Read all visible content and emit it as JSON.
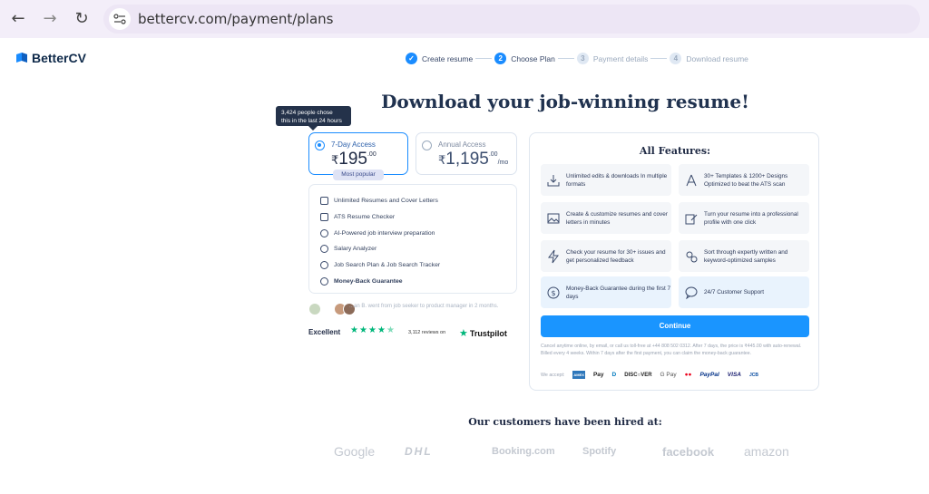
{
  "browser": {
    "url": "bettercv.com/payment/plans",
    "back_icon": "←",
    "forward_icon": "→",
    "reload_icon": "↻"
  },
  "logo": {
    "text": "BetterCV"
  },
  "steps": [
    {
      "label": "Create resume",
      "marker": "✓",
      "state": "done"
    },
    {
      "label": "Choose Plan",
      "marker": "2",
      "state": "active"
    },
    {
      "label": "Payment details",
      "marker": "3",
      "state": "upcoming"
    },
    {
      "label": "Download resume",
      "marker": "4",
      "state": "upcoming"
    }
  ],
  "title": "Download your job-winning resume!",
  "tooltip": {
    "line1": "3,424 people chose",
    "line2": "this in the last 24 hours"
  },
  "plans": [
    {
      "name": "7-Day Access",
      "currency": "₹",
      "amount": "195",
      "decimals": ".00",
      "per": "",
      "selected": true,
      "badge": "Most popular"
    },
    {
      "name": "Annual Access",
      "currency": "₹",
      "amount": "1,195",
      "decimals": ".00",
      "per": "/mo",
      "selected": false
    }
  ],
  "plan_features": [
    "Unlimited Resumes and Cover Letters",
    "ATS Resume Checker",
    "AI-Powered job interview preparation",
    "Salary Analyzer",
    "Job Search Plan & Job Search Tracker",
    "Money-Back Guarantee"
  ],
  "review": {
    "text": "...an B. went from job seeker to product manager in 2 months.",
    "rating_label": "Excellent",
    "stars": 4.5,
    "count": "3,112 reviews on",
    "provider": "Trustpilot"
  },
  "all_features": {
    "title": "All Features:",
    "tiles": [
      {
        "text": "Unlimited edits & downloads In multiple formats",
        "icon": "download-icon"
      },
      {
        "text": "30+ Templates & 1200+ Designs Optimized to beat the ATS scan",
        "icon": "compass-icon"
      },
      {
        "text": "Create & customize resumes and cover letters in minutes",
        "icon": "image-icon"
      },
      {
        "text": "Turn your resume into a professional profile with one click",
        "icon": "edit-icon"
      },
      {
        "text": "Check your resume for 30+ issues and get personalized feedback",
        "icon": "bolt-icon"
      },
      {
        "text": "Sort through expertly written and keyword-optimized samples",
        "icon": "gears-icon"
      },
      {
        "text": "Money-Back Guarantee during the first 7 days",
        "icon": "money-icon"
      },
      {
        "text": "24/7 Customer Support",
        "icon": "chat-icon"
      }
    ],
    "continue_label": "Continue",
    "fine_print": "Cancel anytime online, by email, or call us toll-free at +44 808 502 0312. After 7 days, the price is ₹445.00 with auto-renewal. Billed every 4 weeks. Within 7 days after the first payment, you can claim the money-back guarantee.",
    "we_accept": "We accept:",
    "payment_methods": [
      "AMEX",
      "Pay",
      "D",
      "DISC○VER",
      "G Pay",
      "●●",
      "PayPal",
      "VISA",
      "JCB"
    ]
  },
  "customers": {
    "title": "Our customers have been hired at:",
    "brands": [
      "Google",
      "DHL",
      "Booking.com",
      "Spotify",
      "facebook",
      "amazon"
    ]
  },
  "colors": {
    "accent": "#1a95ff",
    "trustpilot": "#00b67a",
    "tile_blue": "#e9f3fd"
  }
}
